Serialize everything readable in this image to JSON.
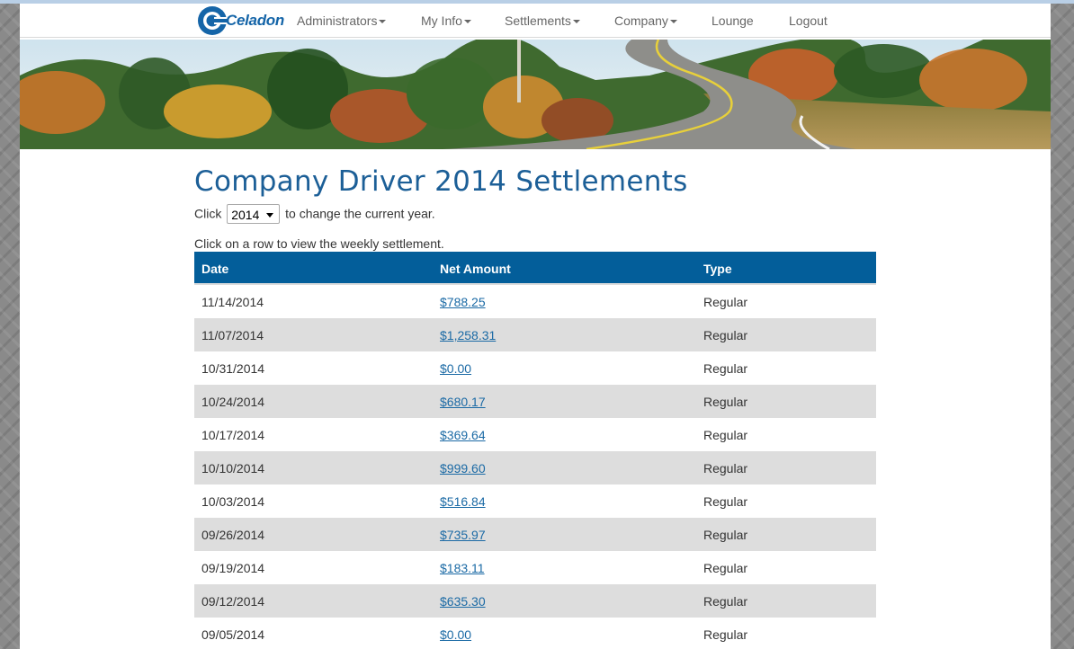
{
  "brand": {
    "name": "Celadon",
    "logo_icon": "celadon-c-logo",
    "brand_color": "#1565a8"
  },
  "nav": {
    "items": [
      {
        "label": "Administrators",
        "dropdown": true
      },
      {
        "label": "My Info",
        "dropdown": true
      },
      {
        "label": "Settlements",
        "dropdown": true
      },
      {
        "label": "Company",
        "dropdown": true
      },
      {
        "label": "Lounge",
        "dropdown": false
      },
      {
        "label": "Logout",
        "dropdown": false
      }
    ]
  },
  "hero": {
    "image": "autumn-road-banner"
  },
  "page": {
    "title": "Company Driver 2014 Settlements",
    "year_prefix": "Click",
    "year_selected": "2014",
    "year_suffix": "to change the current year.",
    "hint": "Click on a row to view the weekly settlement."
  },
  "table": {
    "header_color": "#035e9a",
    "columns": [
      "Date",
      "Net Amount",
      "Type"
    ],
    "rows": [
      {
        "date": "11/14/2014",
        "amount": "$788.25",
        "type": "Regular"
      },
      {
        "date": "11/07/2014",
        "amount": "$1,258.31",
        "type": "Regular"
      },
      {
        "date": "10/31/2014",
        "amount": "$0.00",
        "type": "Regular"
      },
      {
        "date": "10/24/2014",
        "amount": "$680.17",
        "type": "Regular"
      },
      {
        "date": "10/17/2014",
        "amount": "$369.64",
        "type": "Regular"
      },
      {
        "date": "10/10/2014",
        "amount": "$999.60",
        "type": "Regular"
      },
      {
        "date": "10/03/2014",
        "amount": "$516.84",
        "type": "Regular"
      },
      {
        "date": "09/26/2014",
        "amount": "$735.97",
        "type": "Regular"
      },
      {
        "date": "09/19/2014",
        "amount": "$183.11",
        "type": "Regular"
      },
      {
        "date": "09/12/2014",
        "amount": "$635.30",
        "type": "Regular"
      },
      {
        "date": "09/05/2014",
        "amount": "$0.00",
        "type": "Regular"
      }
    ]
  }
}
